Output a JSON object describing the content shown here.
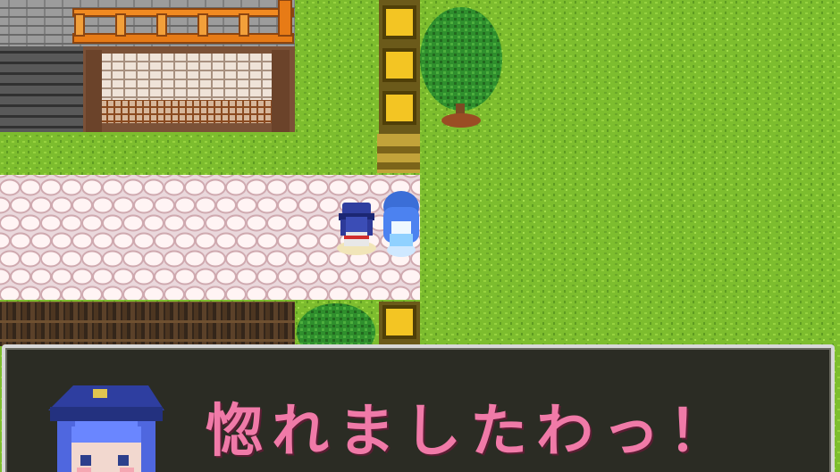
{
  "scene": {
    "name": "village-map",
    "colors": {
      "grass": "#7dbd2e",
      "path": "#f3dfe2",
      "wood": "#8b4a1e",
      "lantern": "#f0c21a",
      "textbox": "#2b2c24",
      "dialog_text": "#f07aa8"
    }
  },
  "dialog": {
    "speaker_icon": "blue-haired-police-girl-portrait",
    "text": "惚れましたわっ！"
  }
}
